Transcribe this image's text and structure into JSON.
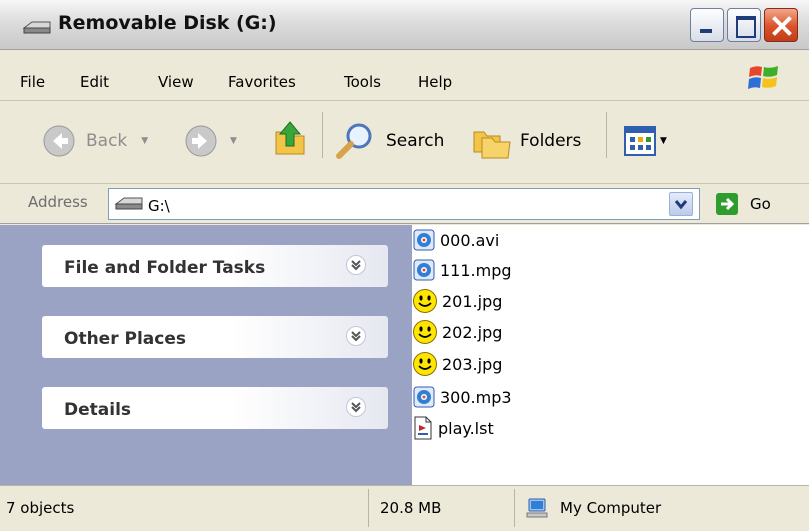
{
  "window": {
    "title": "Removable Disk (G:)"
  },
  "menu": {
    "items": [
      "File",
      "Edit",
      "View",
      "Favorites",
      "Tools",
      "Help"
    ]
  },
  "toolbar": {
    "back_label": "Back",
    "search_label": "Search",
    "folders_label": "Folders"
  },
  "address": {
    "label": "Address",
    "value": "G:\\",
    "go_label": "Go"
  },
  "task_pane": {
    "sections": [
      "File and Folder Tasks",
      "Other Places",
      "Details"
    ]
  },
  "files": [
    {
      "name": "000.avi",
      "icon": "media-player-icon"
    },
    {
      "name": "111.mpg",
      "icon": "media-player-icon"
    },
    {
      "name": "201.jpg",
      "icon": "smiley-image-icon"
    },
    {
      "name": "202.jpg",
      "icon": "smiley-image-icon"
    },
    {
      "name": "203.jpg",
      "icon": "smiley-image-icon"
    },
    {
      "name": "300.mp3",
      "icon": "media-player-icon"
    },
    {
      "name": "play.lst",
      "icon": "playlist-file-icon"
    }
  ],
  "status": {
    "objects": "7 objects",
    "size": "20.8 MB",
    "zone": "My Computer"
  },
  "colors": {
    "task_pane_bg": "#9aa3c4",
    "chrome_bg": "#ece9d8",
    "close_button": "#d9532b",
    "go_green": "#2e9d2e"
  }
}
